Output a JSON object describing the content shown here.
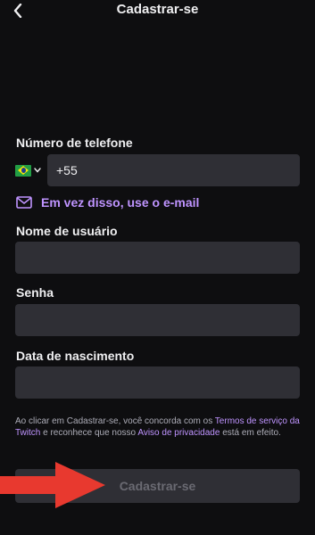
{
  "header": {
    "title": "Cadastrar-se",
    "back_icon": "chevron-left-icon"
  },
  "phone": {
    "label": "Número de telefone",
    "country": "Brazil",
    "flag_icon": "brazil-flag-icon",
    "value": "+55"
  },
  "email_switch": {
    "icon": "mail-icon",
    "label": "Em vez disso, use o e-mail"
  },
  "username": {
    "label": "Nome de usuário",
    "value": ""
  },
  "password": {
    "label": "Senha",
    "value": ""
  },
  "birthdate": {
    "label": "Data de nascimento",
    "value": ""
  },
  "terms": {
    "part1": "Ao clicar em Cadastrar-se, você concorda com os ",
    "link1": "Termos de serviço da Twitch",
    "part2": " e reconhece que nosso ",
    "link2": "Aviso de privacidade",
    "part3": " está em efeito."
  },
  "submit": {
    "label": "Cadastrar-se"
  },
  "colors": {
    "background": "#0e0e10",
    "field": "#2f2f35",
    "accent": "#bf94ff",
    "annotation_arrow": "#e8392f"
  },
  "annotation": {
    "icon": "red-arrow-icon"
  }
}
